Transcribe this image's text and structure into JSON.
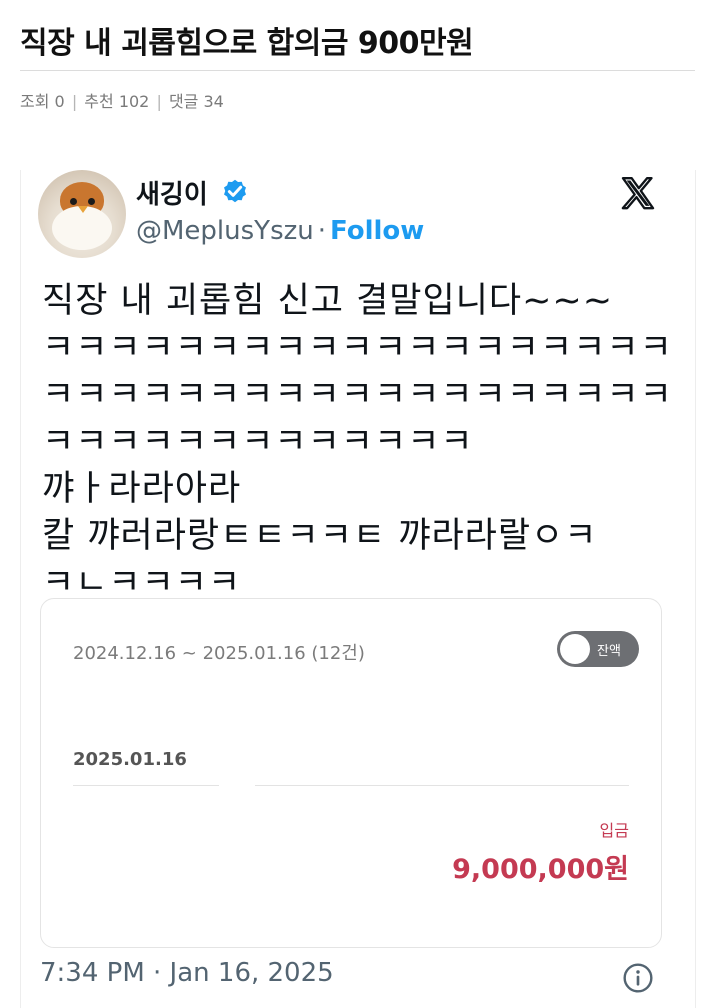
{
  "post": {
    "title": "직장 내 괴롭힘으로 합의금 900만원",
    "views_label": "조회 0",
    "recommend_label": "추천 102",
    "comments_label": "댓글 34",
    "separator": "|"
  },
  "tweet": {
    "display_name": "새깅이",
    "handle": "@MeplusYszu",
    "dot": "·",
    "follow_label": "Follow",
    "verified": true,
    "text": "직장 내 괴롭힘 신고 결말입니다~~~\nㅋㅋㅋㅋㅋㅋㅋㅋㅋㅋㅋㅋㅋㅋㅋㅋㅋㅋㅋ\nㅋㅋㅋㅋㅋㅋㅋㅋㅋㅋㅋㅋㅋㅋㅋㅋㅋㅋㅋ\nㅋㅋㅋㅋㅋㅋㅋㅋㅋㅋㅋㅋㅋ 꺄ㅏ라라아라\n칼 꺄러라랑ㅌㅌㅋㅋㅌ 꺄라라랄ㅇㅋ\nㅋㄴㅋㅋㅋㅋ",
    "timestamp": "7:34 PM · Jan 16, 2025",
    "icons": {
      "avatar": "bird-avatar",
      "verified": "verified-badge-icon",
      "platform": "x-logo-icon",
      "info": "info-icon"
    },
    "colors": {
      "follow": "#1d9bf0",
      "verified": "#1d9bf0",
      "deposit": "#c43a52"
    }
  },
  "bank": {
    "date_range": "2024.12.16 ~ 2025.01.16 (12건)",
    "toggle_label": "잔액",
    "toggle_on": false,
    "date": "2025.01.16",
    "deposit_label": "입금",
    "deposit_amount": "9,000,000원"
  }
}
